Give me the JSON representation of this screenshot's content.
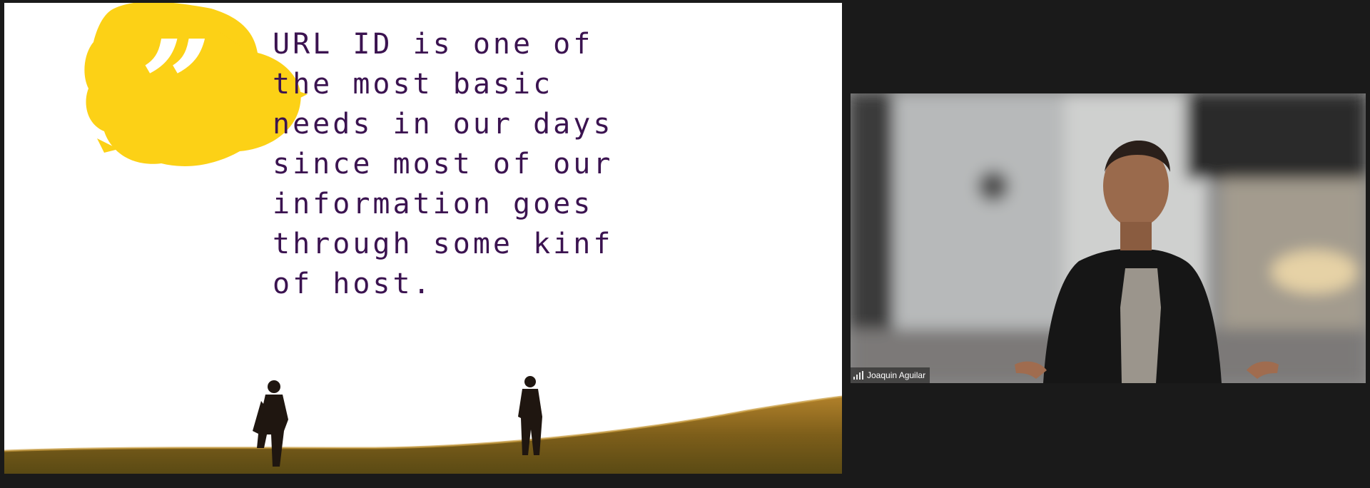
{
  "slide": {
    "quote_text": "URL ID is one of\nthe most basic\nneeds in our days\nsince most of our\ninformation goes\nthrough some kinf\nof host.",
    "quote_mark": "”",
    "colors": {
      "text": "#3b1350",
      "splash": "#fcd116",
      "grass": "#8a6a1e"
    }
  },
  "video": {
    "participant_name": "Joaquin Aguilar",
    "signal_icon": "signal-strength-icon"
  }
}
